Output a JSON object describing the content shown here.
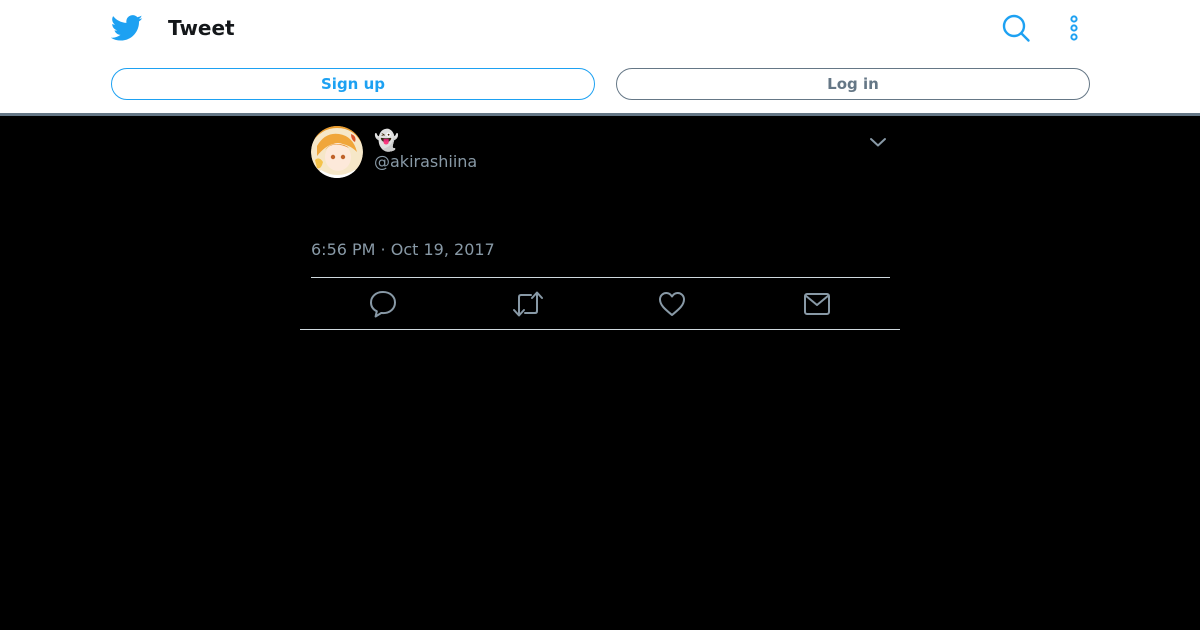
{
  "header": {
    "title": "Tweet",
    "logo_icon": "twitter-bird-icon",
    "search_icon": "search-icon",
    "more_icon": "more-vertical-icon",
    "signup_label": "Sign up",
    "login_label": "Log in"
  },
  "tweet": {
    "display_name": "👻",
    "handle": "@akirashiina",
    "timestamp": "6:56 PM · Oct 19, 2017",
    "actions": [
      "reply-icon",
      "retweet-icon",
      "like-icon",
      "direct-message-icon"
    ]
  },
  "colors": {
    "accent": "#1da1f2",
    "secondary_text": "#8899a6",
    "border": "#657786",
    "background": "#000000"
  }
}
